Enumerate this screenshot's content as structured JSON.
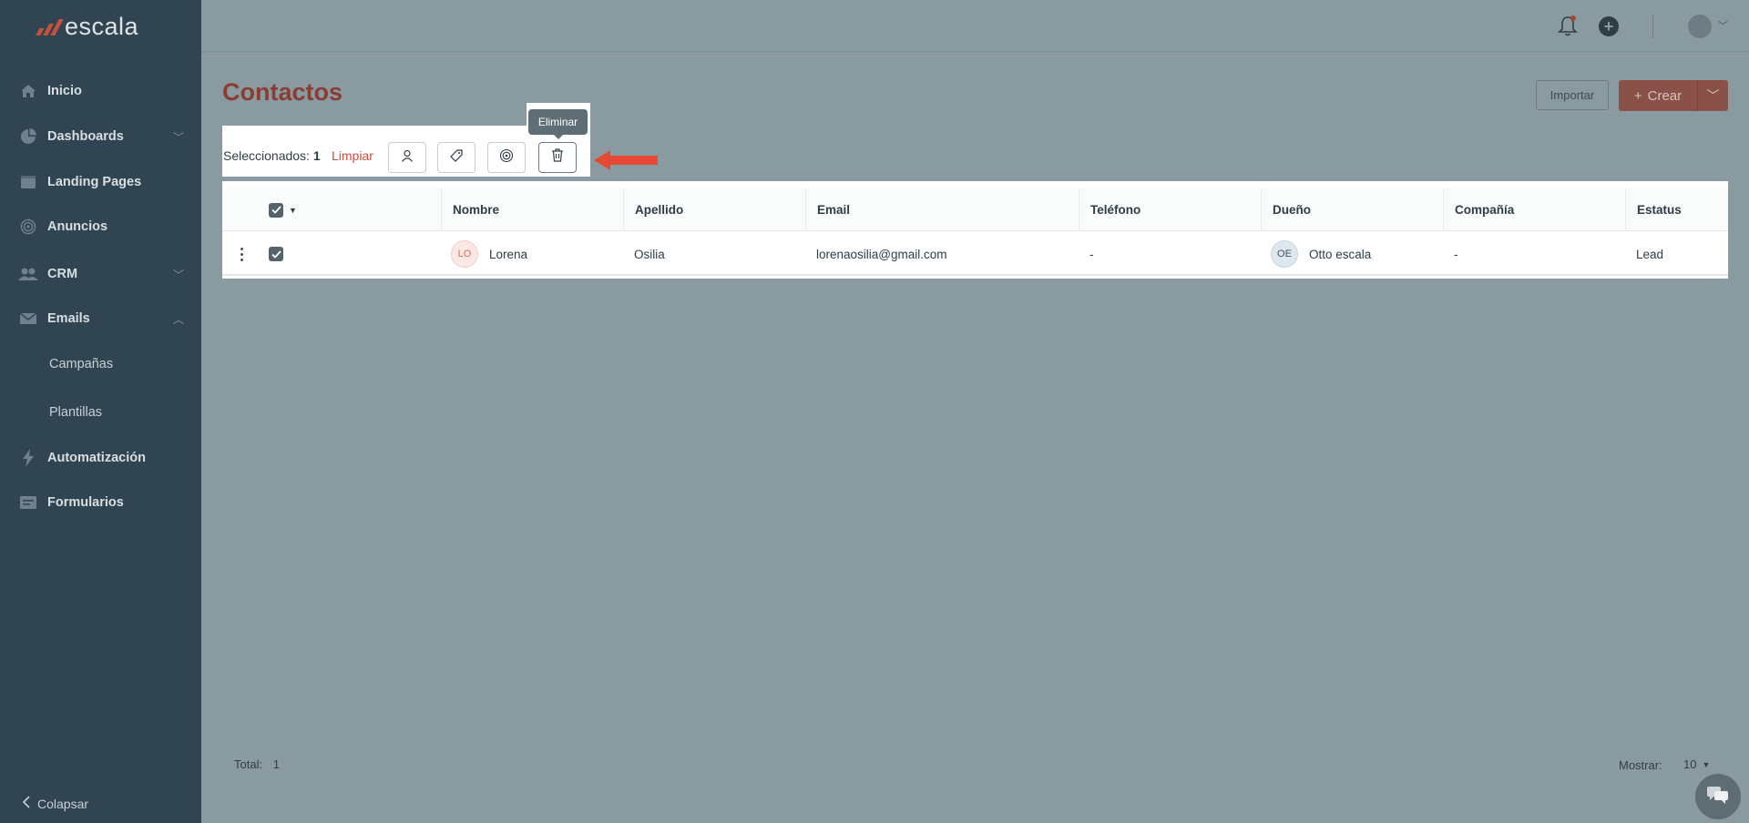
{
  "app": {
    "logo_text": "escala",
    "colors": {
      "sidebar": "#304452",
      "accent": "#d64c3b",
      "overlay": "#8a9aa1"
    }
  },
  "sidebar": {
    "items": [
      {
        "label": "Inicio",
        "icon": "home-icon",
        "expandable": false
      },
      {
        "label": "Dashboards",
        "icon": "pie-chart-icon",
        "expandable": true
      },
      {
        "label": "Landing Pages",
        "icon": "browser-window-icon",
        "expandable": false
      },
      {
        "label": "Anuncios",
        "icon": "target-icon",
        "expandable": false
      },
      {
        "label": "CRM",
        "icon": "users-icon",
        "expandable": true
      },
      {
        "label": "Emails",
        "icon": "envelope-icon",
        "expandable": true,
        "expanded": true
      },
      {
        "label": "Campañas",
        "sub": true
      },
      {
        "label": "Plantillas",
        "sub": true
      },
      {
        "label": "Automatización",
        "icon": "lightning-icon",
        "expandable": false
      },
      {
        "label": "Formularios",
        "icon": "form-icon",
        "expandable": false
      }
    ],
    "collapse_label": "Colapsar"
  },
  "header": {
    "icons": [
      "bell-icon",
      "plus-circle-icon",
      "avatar"
    ]
  },
  "page": {
    "title": "Contactos",
    "import_label": "Importar",
    "create_label": "Crear"
  },
  "selection": {
    "label": "Seleccionados:",
    "count": "1",
    "clear_label": "Limpiar",
    "actions": [
      "user-icon",
      "tag-icon",
      "target-icon",
      "trash-icon"
    ],
    "tooltip": "Eliminar"
  },
  "table": {
    "columns": [
      "Nombre",
      "Apellido",
      "Email",
      "Teléfono",
      "Dueño",
      "Compañía",
      "Estatus"
    ],
    "rows": [
      {
        "initials": "LO",
        "nombre": "Lorena",
        "apellido": "Osilia",
        "email": "lorenaosilia@gmail.com",
        "telefono": "-",
        "dueno_initials": "OE",
        "dueno": "Otto escala",
        "compania": "-",
        "estatus": "Lead"
      }
    ]
  },
  "footer": {
    "total_label": "Total:",
    "total": "1",
    "show_label": "Mostrar:",
    "show_value": "10"
  }
}
